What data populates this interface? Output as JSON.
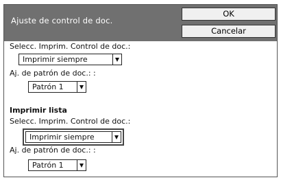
{
  "dialog": {
    "title": "Ajuste de control de doc.",
    "ok_label": "OK",
    "cancel_label": "Cancelar"
  },
  "section1": {
    "select_label": "Selecc. Imprim. Control de doc.:",
    "select_value": "Imprimir siempre",
    "pattern_label": "Aj. de patrón de doc.: :",
    "pattern_value": "Patrón 1"
  },
  "section2": {
    "heading": "Imprimir lista",
    "select_label": "Selecc. Imprim. Control de doc.:",
    "select_value": "Imprimir siempre",
    "pattern_label": "Aj. de patrón de doc.: :",
    "pattern_value": "Patrón 1"
  }
}
